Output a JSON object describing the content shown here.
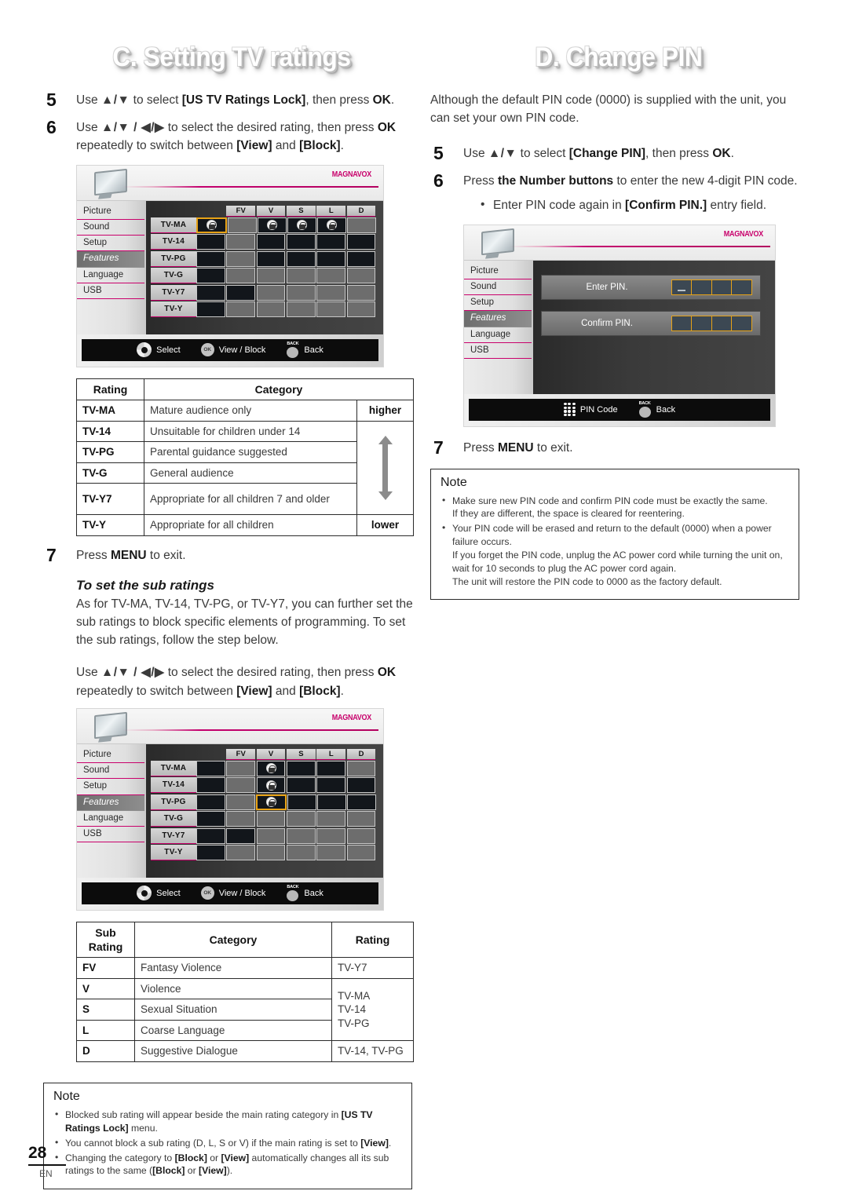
{
  "left": {
    "banner": "C. Setting TV ratings",
    "step5": {
      "num": "5",
      "text_1": "Use ",
      "arrows": "▲/▼",
      "text_2": " to select ",
      "bold_1": "[US TV Ratings Lock]",
      "text_3": ", then press ",
      "bold_2": "OK",
      "text_4": "."
    },
    "step6": {
      "num": "6",
      "text_1": "Use ",
      "arrows": "▲/▼ / ◀/▶",
      "text_2": " to select the desired rating, then press ",
      "bold_1": "OK",
      "text_3": " repeatedly to switch between ",
      "bold_2": "[View]",
      "text_4": " and ",
      "bold_3": "[Block]",
      "text_5": "."
    },
    "step7": {
      "num": "7",
      "text_1": "Press ",
      "bold_1": "MENU",
      "text_2": " to exit."
    },
    "subratings_heading": "To set the sub ratings",
    "subratings_para": "As for TV-MA, TV-14, TV-PG, or TV-Y7, you can further set the sub ratings to block specific elements of programming. To set the sub ratings, follow the step below.",
    "step_sub": {
      "text_1": "Use ",
      "arrows": "▲/▼ / ◀/▶",
      "text_2": " to select the desired rating, then press ",
      "bold_1": "OK",
      "text_3": " repeatedly to switch between ",
      "bold_2": "[View]",
      "text_4": " and ",
      "bold_3": "[Block]",
      "text_5": "."
    },
    "ratings_table": {
      "headers": [
        "Rating",
        "Category"
      ],
      "scale_high": "higher",
      "scale_low": "lower",
      "rows": [
        {
          "rating": "TV-MA",
          "category": "Mature audience only"
        },
        {
          "rating": "TV-14",
          "category": "Unsuitable for children under 14"
        },
        {
          "rating": "TV-PG",
          "category": "Parental guidance suggested"
        },
        {
          "rating": "TV-G",
          "category": "General audience"
        },
        {
          "rating": "TV-Y7",
          "category": "Appropriate for all children 7 and older"
        },
        {
          "rating": "TV-Y",
          "category": "Appropriate for all children"
        }
      ]
    },
    "sub_table": {
      "headers": [
        "Sub Rating",
        "Category",
        "Rating"
      ],
      "rows": [
        {
          "sub": "FV",
          "category": "Fantasy Violence",
          "rating": "TV-Y7"
        },
        {
          "sub": "V",
          "category": "Violence",
          "rating": "TV-MA"
        },
        {
          "sub": "S",
          "category": "Sexual Situation",
          "rating": "TV-14"
        },
        {
          "sub": "L",
          "category": "Coarse Language",
          "rating": "TV-PG"
        },
        {
          "sub": "D",
          "category": "Suggestive Dialogue",
          "rating": "TV-14, TV-PG"
        }
      ]
    },
    "note": {
      "title": "Note",
      "items": [
        {
          "part_1": "Blocked sub rating will appear beside the main rating category in ",
          "bold_1": "[US TV Ratings Lock]",
          "part_2": " menu."
        },
        {
          "part_1": "You cannot block a sub rating (D, L, S or V) if the main rating is set to ",
          "bold_1": "[View]",
          "part_2": "."
        },
        {
          "part_1": "Changing the category to ",
          "bold_1": "[Block]",
          "part_2": " or ",
          "bold_2": "[View]",
          "part_3": " automatically changes all its sub ratings to the same (",
          "bold_3": "[Block]",
          "part_4": " or ",
          "bold_4": "[View]",
          "part_5": ")."
        }
      ]
    }
  },
  "right": {
    "banner": "D. Change PIN",
    "intro": "Although the default PIN code (0000) is supplied with the unit, you can set your own PIN code.",
    "step5": {
      "num": "5",
      "text_1": "Use ",
      "arrows": "▲/▼",
      "text_2": " to select ",
      "bold_1": "[Change PIN]",
      "text_3": ", then press ",
      "bold_2": "OK",
      "text_4": "."
    },
    "step6": {
      "num": "6",
      "text_1": "Press ",
      "bold_1": "the Number buttons",
      "text_2": " to enter the new 4-digit PIN code.",
      "bullet_1": "Enter PIN code again in ",
      "bullet_bold": "[Confirm PIN.]",
      "bullet_2": " entry field."
    },
    "step7": {
      "num": "7",
      "text_1": "Press ",
      "bold_1": "MENU",
      "text_2": " to exit."
    },
    "note": {
      "title": "Note",
      "items": [
        {
          "line_1": "Make sure new PIN code and confirm PIN code must be exactly the same.",
          "line_2": "If they are different, the space is cleared for reentering."
        },
        {
          "line_1": "Your PIN code will be erased and return to the default (0000) when a power failure occurs.",
          "line_2": "If you forget the PIN code, unplug the AC power cord while turning the unit on, wait for 10 seconds to plug the AC power cord again.",
          "line_3": "The unit will restore the PIN code to 0000 as the factory default."
        }
      ]
    }
  },
  "tv_ui": {
    "brand": "MAGNAVOX",
    "menu_items": [
      "Picture",
      "Sound",
      "Setup",
      "Features",
      "Language",
      "USB"
    ],
    "active_menu": "Features",
    "grid_columns": [
      "FV",
      "V",
      "S",
      "L",
      "D"
    ],
    "grid_rows": [
      "TV-MA",
      "TV-14",
      "TV-PG",
      "TV-G",
      "TV-Y7",
      "TV-Y"
    ],
    "bar": {
      "select": "Select",
      "view_block": "View / Block",
      "back": "Back",
      "back_cap": "BACK",
      "ok_cap": "OK",
      "pin_code": "PIN Code"
    },
    "pin_screen": {
      "enter_label": "Enter PIN.",
      "confirm_label": "Confirm PIN."
    },
    "screen1_cells": [
      [
        "dark-lock-sel",
        "gray",
        "dark-lock",
        "dark-lock",
        "dark-lock",
        "gray"
      ],
      [
        "dark",
        "gray",
        "dark",
        "dark",
        "dark",
        "dark"
      ],
      [
        "dark",
        "gray",
        "dark",
        "dark",
        "dark",
        "dark"
      ],
      [
        "dark",
        "gray",
        "gray",
        "gray",
        "gray",
        "gray"
      ],
      [
        "dark",
        "dark",
        "gray",
        "gray",
        "gray",
        "gray"
      ],
      [
        "dark",
        "gray",
        "gray",
        "gray",
        "gray",
        "gray"
      ]
    ],
    "screen2_cells": [
      [
        "dark",
        "gray",
        "dark-lock",
        "dark",
        "dark",
        "gray"
      ],
      [
        "dark",
        "gray",
        "dark-lock",
        "dark",
        "dark",
        "dark"
      ],
      [
        "dark",
        "gray",
        "dark-lock-sel",
        "dark",
        "dark",
        "dark"
      ],
      [
        "dark",
        "gray",
        "gray",
        "gray",
        "gray",
        "gray"
      ],
      [
        "dark",
        "dark",
        "gray",
        "gray",
        "gray",
        "gray"
      ],
      [
        "dark",
        "gray",
        "gray",
        "gray",
        "gray",
        "gray"
      ]
    ]
  },
  "footer": {
    "page": "28",
    "lang": "EN"
  }
}
